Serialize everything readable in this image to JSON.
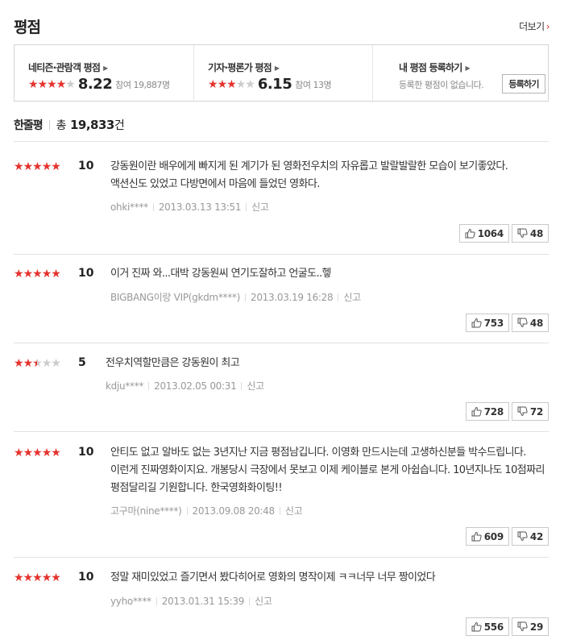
{
  "header": {
    "title": "평점",
    "more_label": "더보기"
  },
  "summary": {
    "netizen": {
      "label": "네티즌·관람객 평점",
      "stars": [
        "on",
        "on",
        "on",
        "on",
        "off"
      ],
      "score": "8.22",
      "count": "참여 19,887명"
    },
    "critic": {
      "label": "기자·평론가 평점",
      "stars": [
        "on",
        "on",
        "on",
        "off",
        "off"
      ],
      "score": "6.15",
      "count": "참여 13명"
    },
    "mine": {
      "label": "내 평점 등록하기",
      "empty_msg": "등록한 평점이 없습니다.",
      "button": "등록하기"
    }
  },
  "count_header": {
    "label": "한줄평",
    "total": "총",
    "number": "19,833",
    "unit": "건"
  },
  "reviews": [
    {
      "stars": [
        "on",
        "on",
        "on",
        "on",
        "on"
      ],
      "score": "10",
      "text": "강동원이란 배우에게 빠지게 된 계기가 된 영화전우치의 자유롭고 발랄발랄한 모습이 보기좋았다. 액션신도 있었고 다방면에서 마음에 들었던 영화다.",
      "user": "ohki****",
      "date": "2013.03.13 13:51",
      "report": "신고",
      "likes": "1064",
      "dislikes": "48"
    },
    {
      "stars": [
        "on",
        "on",
        "on",
        "on",
        "on"
      ],
      "score": "10",
      "text": "이거 진짜 와...대박 강동원씨 연기도잘하고 언굴도..헿",
      "user": "BIGBANG이랑 VIP(gkdm****)",
      "date": "2013.03.19 16:28",
      "report": "신고",
      "likes": "753",
      "dislikes": "48"
    },
    {
      "stars": [
        "on",
        "on",
        "half",
        "off",
        "off"
      ],
      "score": "5",
      "text": "전우치역할만큼은 강동원이 최고",
      "user": "kdju****",
      "date": "2013.02.05 00:31",
      "report": "신고",
      "likes": "728",
      "dislikes": "72"
    },
    {
      "stars": [
        "on",
        "on",
        "on",
        "on",
        "on"
      ],
      "score": "10",
      "text": "안티도 없고 알바도 없는 3년지난 지금 평점남깁니다. 이영화 만드시는데 고생하신분들 박수드립니다. 이런게 진짜영화이지요. 개봉당시 극장에서 못보고 이제 케이블로 본게 아쉽습니다. 10년지나도 10점짜리 평점달리길 기원합니다. 한국영화화이팅!!",
      "user": "고구마(nine****)",
      "date": "2013.09.08 20:48",
      "report": "신고",
      "likes": "609",
      "dislikes": "42"
    },
    {
      "stars": [
        "on",
        "on",
        "on",
        "on",
        "on"
      ],
      "score": "10",
      "text": "정말 재미있었고 즐기면서 봤다히어로 영화의 명작이제 ㅋㅋ너무 너무 짱이었다",
      "user": "yyho****",
      "date": "2013.01.31 15:39",
      "report": "신고",
      "likes": "556",
      "dislikes": "29"
    }
  ]
}
